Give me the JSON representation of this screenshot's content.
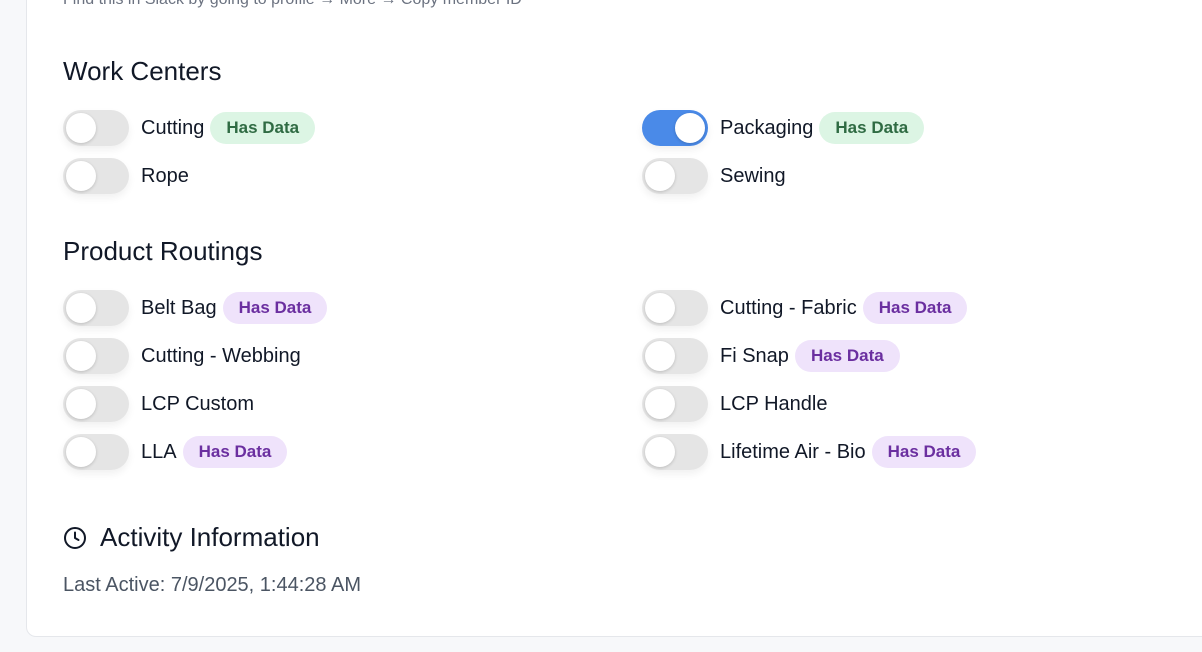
{
  "hint_text": "Find this in Slack by going to profile → More → Copy member ID",
  "work_centers": {
    "title": "Work Centers",
    "items": [
      {
        "label": "Cutting",
        "enabled": false,
        "badge": "Has Data"
      },
      {
        "label": "Packaging",
        "enabled": true,
        "badge": "Has Data"
      },
      {
        "label": "Rope",
        "enabled": false,
        "badge": ""
      },
      {
        "label": "Sewing",
        "enabled": false,
        "badge": ""
      }
    ]
  },
  "product_routings": {
    "title": "Product Routings",
    "items": [
      {
        "label": "Belt Bag",
        "enabled": false,
        "badge": "Has Data"
      },
      {
        "label": "Cutting - Fabric",
        "enabled": false,
        "badge": "Has Data"
      },
      {
        "label": "Cutting - Webbing",
        "enabled": false,
        "badge": ""
      },
      {
        "label": "Fi Snap",
        "enabled": false,
        "badge": "Has Data"
      },
      {
        "label": "LCP Custom",
        "enabled": false,
        "badge": ""
      },
      {
        "label": "LCP Handle",
        "enabled": false,
        "badge": ""
      },
      {
        "label": "LLA",
        "enabled": false,
        "badge": "Has Data"
      },
      {
        "label": "Lifetime Air - Bio",
        "enabled": false,
        "badge": "Has Data"
      }
    ]
  },
  "activity": {
    "title": "Activity Information",
    "icon": "clock-icon",
    "last_active": "Last Active: 7/9/2025, 1:44:28 AM"
  },
  "colors": {
    "toggle_on": "#4a8ae8",
    "toggle_off": "#e5e5e5",
    "work_center_badge_bg": "#dcf5e4",
    "work_center_badge_text": "#2f6b43",
    "routing_badge_bg": "#efe3fb",
    "routing_badge_text": "#6b2fa0"
  }
}
